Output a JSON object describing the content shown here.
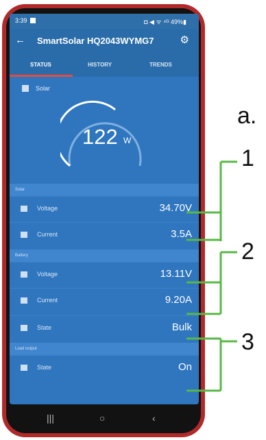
{
  "status_bar": {
    "time": "3:39",
    "indicators": "◘ ◀ ᯤ ⁴ᴳ 49%▮"
  },
  "app_bar": {
    "title": "SmartSolar HQ2043WYMG7",
    "back_icon": "arrow-left",
    "settings_icon": "gear"
  },
  "tabs": [
    {
      "label": "STATUS",
      "active": true
    },
    {
      "label": "HISTORY",
      "active": false
    },
    {
      "label": "TRENDS",
      "active": false
    }
  ],
  "solar_card": {
    "label": "Solar",
    "power_value": "122",
    "power_unit": "W"
  },
  "sections": {
    "solar": {
      "header": "Solar",
      "voltage_label": "Voltage",
      "voltage_value": "34.70V",
      "current_label": "Current",
      "current_value": "3.5A"
    },
    "battery": {
      "header": "Battery",
      "voltage_label": "Voltage",
      "voltage_value": "13.11V",
      "current_label": "Current",
      "current_value": "9.20A",
      "state_label": "State",
      "state_value": "Bulk"
    },
    "load": {
      "header": "Load output",
      "state_label": "State",
      "state_value": "On"
    }
  },
  "annotations": {
    "a": "a.",
    "one": "1",
    "two": "2",
    "three": "3"
  },
  "colors": {
    "screen_blue": "#2f76bf",
    "tab_indicator": "#e84b3c",
    "annotation_green": "#58b847",
    "phone_frame": "#b12a2a"
  }
}
